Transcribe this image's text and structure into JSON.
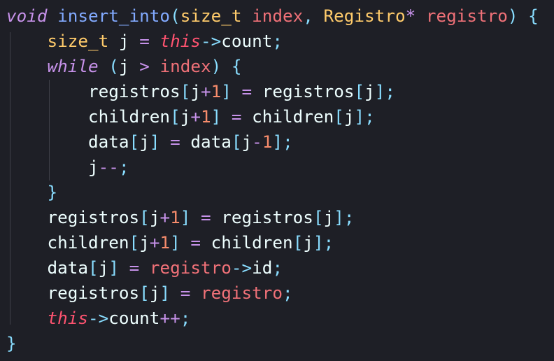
{
  "editor": {
    "language": "cpp",
    "indent_guide_color": "#3e3f48",
    "background": "#1e1f26"
  },
  "lines": [
    [
      {
        "t": "void",
        "c": "kwi"
      },
      {
        "t": " ",
        "c": "id"
      },
      {
        "t": "insert_into",
        "c": "fn"
      },
      {
        "t": "(",
        "c": "br"
      },
      {
        "t": "size_t",
        "c": "type"
      },
      {
        "t": " ",
        "c": "id"
      },
      {
        "t": "index",
        "c": "par"
      },
      {
        "t": ", ",
        "c": "pun"
      },
      {
        "t": "Registro",
        "c": "type"
      },
      {
        "t": "*",
        "c": "op"
      },
      {
        "t": " ",
        "c": "id"
      },
      {
        "t": "registro",
        "c": "par"
      },
      {
        "t": ")",
        "c": "br"
      },
      {
        "t": " ",
        "c": "id"
      },
      {
        "t": "{",
        "c": "br"
      }
    ],
    [
      {
        "t": "    ",
        "c": "id"
      },
      {
        "t": "size_t",
        "c": "type"
      },
      {
        "t": " j ",
        "c": "id"
      },
      {
        "t": "=",
        "c": "op"
      },
      {
        "t": " ",
        "c": "id"
      },
      {
        "t": "this",
        "c": "this"
      },
      {
        "t": "->",
        "c": "arrow"
      },
      {
        "t": "count",
        "c": "id"
      },
      {
        "t": ";",
        "c": "pun"
      }
    ],
    [
      {
        "t": "    ",
        "c": "id"
      },
      {
        "t": "while",
        "c": "kwi"
      },
      {
        "t": " ",
        "c": "id"
      },
      {
        "t": "(",
        "c": "pun"
      },
      {
        "t": "j ",
        "c": "id"
      },
      {
        "t": ">",
        "c": "op"
      },
      {
        "t": " ",
        "c": "id"
      },
      {
        "t": "index",
        "c": "par"
      },
      {
        "t": ")",
        "c": "pun"
      },
      {
        "t": " ",
        "c": "id"
      },
      {
        "t": "{",
        "c": "pun"
      }
    ],
    [
      {
        "t": "        ",
        "c": "id"
      },
      {
        "t": "registros",
        "c": "id"
      },
      {
        "t": "[",
        "c": "pun"
      },
      {
        "t": "j",
        "c": "id"
      },
      {
        "t": "+",
        "c": "op"
      },
      {
        "t": "1",
        "c": "num"
      },
      {
        "t": "]",
        "c": "pun"
      },
      {
        "t": " ",
        "c": "id"
      },
      {
        "t": "=",
        "c": "op"
      },
      {
        "t": " registros",
        "c": "id"
      },
      {
        "t": "[",
        "c": "pun"
      },
      {
        "t": "j",
        "c": "id"
      },
      {
        "t": "]",
        "c": "pun"
      },
      {
        "t": ";",
        "c": "pun"
      }
    ],
    [
      {
        "t": "        ",
        "c": "id"
      },
      {
        "t": "children",
        "c": "id"
      },
      {
        "t": "[",
        "c": "pun"
      },
      {
        "t": "j",
        "c": "id"
      },
      {
        "t": "+",
        "c": "op"
      },
      {
        "t": "1",
        "c": "num"
      },
      {
        "t": "]",
        "c": "pun"
      },
      {
        "t": " ",
        "c": "id"
      },
      {
        "t": "=",
        "c": "op"
      },
      {
        "t": " children",
        "c": "id"
      },
      {
        "t": "[",
        "c": "pun"
      },
      {
        "t": "j",
        "c": "id"
      },
      {
        "t": "]",
        "c": "pun"
      },
      {
        "t": ";",
        "c": "pun"
      }
    ],
    [
      {
        "t": "        ",
        "c": "id"
      },
      {
        "t": "data",
        "c": "id"
      },
      {
        "t": "[",
        "c": "pun"
      },
      {
        "t": "j",
        "c": "id"
      },
      {
        "t": "]",
        "c": "pun"
      },
      {
        "t": " ",
        "c": "id"
      },
      {
        "t": "=",
        "c": "op"
      },
      {
        "t": " data",
        "c": "id"
      },
      {
        "t": "[",
        "c": "pun"
      },
      {
        "t": "j",
        "c": "id"
      },
      {
        "t": "-",
        "c": "op"
      },
      {
        "t": "1",
        "c": "num"
      },
      {
        "t": "]",
        "c": "pun"
      },
      {
        "t": ";",
        "c": "pun"
      }
    ],
    [
      {
        "t": "        ",
        "c": "id"
      },
      {
        "t": "j",
        "c": "id"
      },
      {
        "t": "--",
        "c": "op"
      },
      {
        "t": ";",
        "c": "pun"
      }
    ],
    [
      {
        "t": "    ",
        "c": "id"
      },
      {
        "t": "}",
        "c": "pun"
      }
    ],
    [
      {
        "t": "    ",
        "c": "id"
      },
      {
        "t": "registros",
        "c": "id"
      },
      {
        "t": "[",
        "c": "pun"
      },
      {
        "t": "j",
        "c": "id"
      },
      {
        "t": "+",
        "c": "op"
      },
      {
        "t": "1",
        "c": "num"
      },
      {
        "t": "]",
        "c": "pun"
      },
      {
        "t": " ",
        "c": "id"
      },
      {
        "t": "=",
        "c": "op"
      },
      {
        "t": " registros",
        "c": "id"
      },
      {
        "t": "[",
        "c": "pun"
      },
      {
        "t": "j",
        "c": "id"
      },
      {
        "t": "]",
        "c": "pun"
      },
      {
        "t": ";",
        "c": "pun"
      }
    ],
    [
      {
        "t": "    ",
        "c": "id"
      },
      {
        "t": "children",
        "c": "id"
      },
      {
        "t": "[",
        "c": "pun"
      },
      {
        "t": "j",
        "c": "id"
      },
      {
        "t": "+",
        "c": "op"
      },
      {
        "t": "1",
        "c": "num"
      },
      {
        "t": "]",
        "c": "pun"
      },
      {
        "t": " ",
        "c": "id"
      },
      {
        "t": "=",
        "c": "op"
      },
      {
        "t": " children",
        "c": "id"
      },
      {
        "t": "[",
        "c": "pun"
      },
      {
        "t": "j",
        "c": "id"
      },
      {
        "t": "]",
        "c": "pun"
      },
      {
        "t": ";",
        "c": "pun"
      }
    ],
    [
      {
        "t": "    ",
        "c": "id"
      },
      {
        "t": "data",
        "c": "id"
      },
      {
        "t": "[",
        "c": "pun"
      },
      {
        "t": "j",
        "c": "id"
      },
      {
        "t": "]",
        "c": "pun"
      },
      {
        "t": " ",
        "c": "id"
      },
      {
        "t": "=",
        "c": "op"
      },
      {
        "t": " ",
        "c": "id"
      },
      {
        "t": "registro",
        "c": "par"
      },
      {
        "t": "->",
        "c": "arrow"
      },
      {
        "t": "id",
        "c": "id"
      },
      {
        "t": ";",
        "c": "pun"
      }
    ],
    [
      {
        "t": "    ",
        "c": "id"
      },
      {
        "t": "registros",
        "c": "id"
      },
      {
        "t": "[",
        "c": "pun"
      },
      {
        "t": "j",
        "c": "id"
      },
      {
        "t": "]",
        "c": "pun"
      },
      {
        "t": " ",
        "c": "id"
      },
      {
        "t": "=",
        "c": "op"
      },
      {
        "t": " ",
        "c": "id"
      },
      {
        "t": "registro",
        "c": "par"
      },
      {
        "t": ";",
        "c": "pun"
      }
    ],
    [
      {
        "t": "    ",
        "c": "id"
      },
      {
        "t": "this",
        "c": "this"
      },
      {
        "t": "->",
        "c": "arrow"
      },
      {
        "t": "count",
        "c": "id"
      },
      {
        "t": "++",
        "c": "op"
      },
      {
        "t": ";",
        "c": "pun"
      }
    ],
    [
      {
        "t": "}",
        "c": "br"
      }
    ]
  ]
}
